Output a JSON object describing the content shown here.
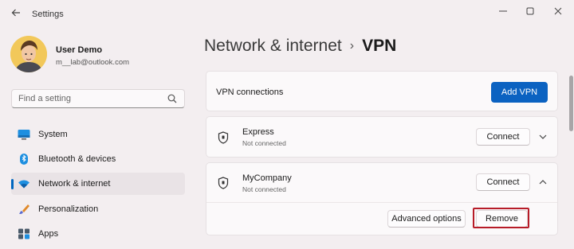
{
  "window": {
    "title": "Settings",
    "controls": [
      "minimize-icon",
      "maximize-icon",
      "close-icon"
    ]
  },
  "profile": {
    "name": "User Demo",
    "email": "m__lab@outlook.com"
  },
  "search": {
    "placeholder": "Find a setting",
    "value": ""
  },
  "nav": {
    "items": [
      {
        "label": "System",
        "icon": "monitor-icon",
        "active": false
      },
      {
        "label": "Bluetooth & devices",
        "icon": "bluetooth-icon",
        "active": false
      },
      {
        "label": "Network & internet",
        "icon": "wifi-icon",
        "active": true
      },
      {
        "label": "Personalization",
        "icon": "brush-icon",
        "active": false
      },
      {
        "label": "Apps",
        "icon": "apps-icon",
        "active": false
      }
    ]
  },
  "breadcrumb": {
    "parent": "Network & internet",
    "separator": "›",
    "current": "VPN"
  },
  "vpn": {
    "header_label": "VPN connections",
    "add_label": "Add VPN",
    "connections": [
      {
        "name": "Express",
        "status": "Not connected",
        "connect_label": "Connect",
        "expanded": false
      },
      {
        "name": "MyCompany",
        "status": "Not connected",
        "connect_label": "Connect",
        "expanded": true
      }
    ],
    "advanced_label": "Advanced options",
    "remove_label": "Remove"
  },
  "colors": {
    "accent": "#0b62c1",
    "highlight": "#b71c28",
    "background": "#f3eef0"
  }
}
